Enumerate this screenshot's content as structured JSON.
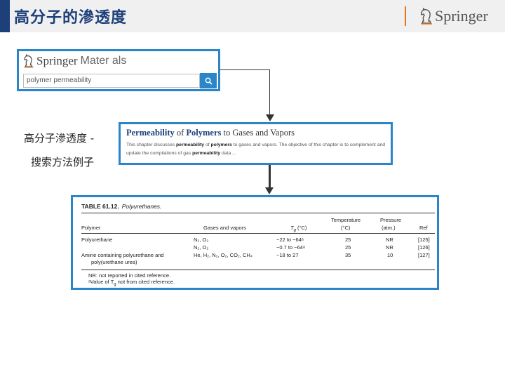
{
  "header": {
    "title": "高分子的滲透度",
    "brand": "Springer",
    "accent_color": "#1d3f7a",
    "divider_color": "#e8741c"
  },
  "springer_materials": {
    "logo_word1": "Springer",
    "logo_word2": "Mater als",
    "search_value": "polymer permeability",
    "search_icon": "search-icon"
  },
  "caption": {
    "line1": "高分子滲透度 -",
    "line2": "搜索方法例子"
  },
  "result": {
    "title_part1": "Permeability",
    "title_part2": " of ",
    "title_part3": "Polymers",
    "title_part4": " to Gases and Vapors",
    "desc_part1": "This chapter discusses ",
    "desc_bold1": "permeability",
    "desc_part2": " of ",
    "desc_bold2": "polymers",
    "desc_part3": " to gases and vapors. The objective of this chapter is to complement and update the compilations of gas ",
    "desc_bold3": "permeability",
    "desc_part4": " data ..."
  },
  "table": {
    "number": "TABLE 61.12.",
    "name": "Polyurethanes.",
    "headers": {
      "polymer": "Polymer",
      "gases": "Gases and vapors",
      "tg": "T",
      "tg_sub": "g",
      "tg_unit": " (°C)",
      "temp_line1": "Temperature",
      "temp_line2": "(°C)",
      "pressure_line1": "Pressure",
      "pressure_line2": "(atm.)",
      "ref": "Ref"
    },
    "rows": [
      {
        "polymer": "Polyurethane",
        "gases": "N₂, O₂",
        "tg": "−22 to −64ᵃ",
        "temp": "25",
        "pressure": "NR",
        "ref": "[125]"
      },
      {
        "polymer": "",
        "gases": "N₂, O₂",
        "tg": "−0.7 to −64ᵃ",
        "temp": "25",
        "pressure": "NR",
        "ref": "[126]"
      },
      {
        "polymer": "Amine containing polyurethane and",
        "polymer2": "poly(urethane urea)",
        "gases": "He, H₂, N₂, O₂, CO₂, CH₄",
        "tg": "−18 to 27",
        "temp": "35",
        "pressure": "10",
        "ref": "[127]"
      }
    ],
    "note1": "NR: not reported in cited reference.",
    "note2": "ᵃValue of T",
    "note2_sub": "g",
    "note2_end": " not from cited reference."
  }
}
